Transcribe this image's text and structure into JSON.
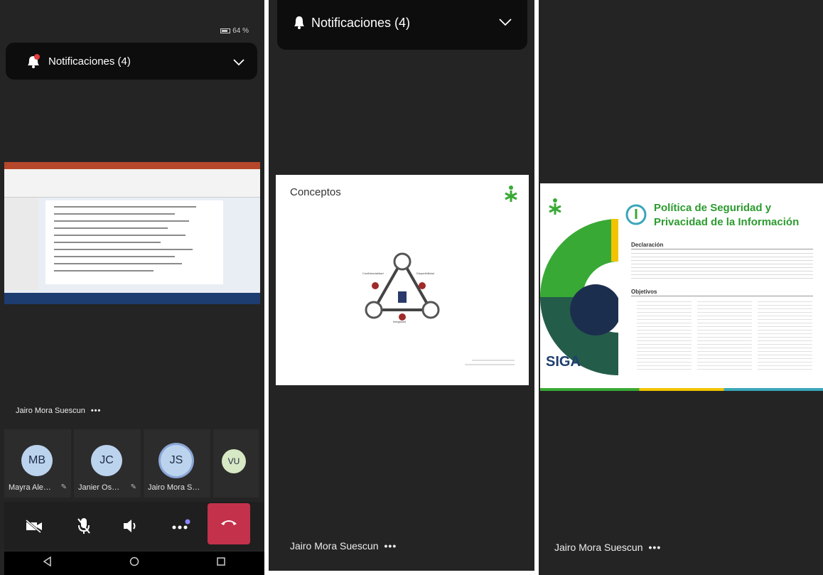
{
  "panel1": {
    "status": {
      "battery": "64 %"
    },
    "notifications": {
      "label": "Notificaciones (4)",
      "badge_icon": "bell-icon",
      "chevron_icon": "chevron-down-icon"
    },
    "presenter": {
      "name": "Jairo Mora Suescun",
      "more": "•••"
    },
    "participants": [
      {
        "initials": "MB",
        "name": "Mayra Ale…"
      },
      {
        "initials": "JC",
        "name": "Janier Os…"
      },
      {
        "initials": "JS",
        "name": "Jairo Mora S…"
      },
      {
        "initials": "VU",
        "name": ""
      }
    ],
    "controls": [
      "camera-off-icon",
      "mic-off-icon",
      "speaker-icon",
      "more-icon",
      "hangup-icon"
    ],
    "nav": [
      "back-icon",
      "home-icon",
      "recents-icon"
    ],
    "colors": {
      "hangup": "#c4314b"
    }
  },
  "panel2": {
    "notifications": {
      "label": "Notificaciones (4)"
    },
    "slide": {
      "title": "Conceptos",
      "diagram_labels": [
        "Confidencialidad",
        "Disponibilidad",
        "Integridad"
      ]
    },
    "presenter": {
      "name": "Jairo Mora Suescun",
      "more": "•••"
    }
  },
  "panel3": {
    "slide": {
      "title_line1": "Política de Seguridad y",
      "title_line2": "Privacidad de la Información",
      "section1": "Declaración",
      "section2": "Objetivos",
      "logo_text": "SIGA"
    },
    "presenter": {
      "name": "Jairo Mora Suescun",
      "more": "•••"
    },
    "colors": {
      "green": "#39a935",
      "title_green": "#2c9b2f",
      "yellow": "#f2c400",
      "teal": "#3aa6b9"
    }
  }
}
